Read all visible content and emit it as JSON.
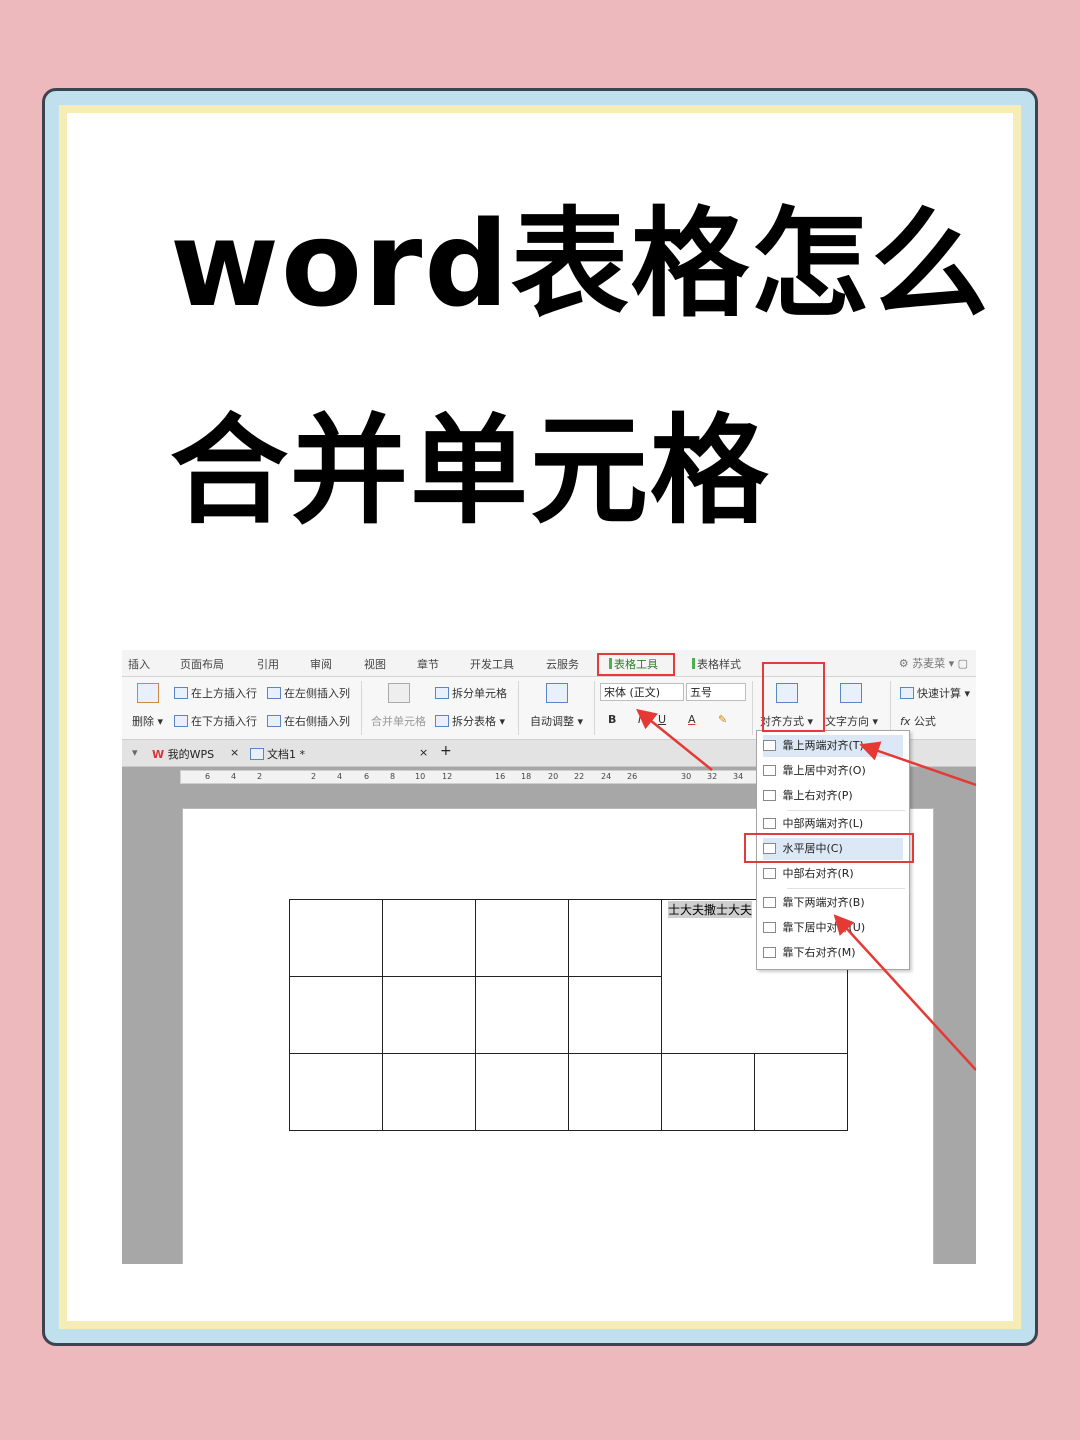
{
  "title": {
    "line1": "word表格怎么",
    "line2": "合并单元格"
  },
  "menubar": {
    "items": [
      "插入",
      "页面布局",
      "引用",
      "审阅",
      "视图",
      "章节",
      "开发工具",
      "云服务",
      "表格工具",
      "表格样式"
    ],
    "user": "苏麦菜"
  },
  "ribbon": {
    "delete": "删除",
    "insert_above": "在上方插入行",
    "insert_below": "在下方插入行",
    "insert_left": "在左侧插入列",
    "insert_right": "在右侧插入列",
    "merge_cells": "合并单元格",
    "split_cells": "拆分单元格",
    "split_table": "拆分表格",
    "auto_fit": "自动调整",
    "font": "宋体 (正文)",
    "size": "五号",
    "bold": "B",
    "italic": "I",
    "underline": "U",
    "font_color": "A",
    "align": "对齐方式",
    "text_direction": "文字方向",
    "quick_calc": "快速计算",
    "formula": "公式",
    "fx": "fx"
  },
  "tabs": {
    "home": "我的WPS",
    "doc": "文档1 *",
    "close": "×",
    "add": "+"
  },
  "ruler": [
    "6",
    "4",
    "2",
    "2",
    "4",
    "6",
    "8",
    "10",
    "12",
    "16",
    "18",
    "20",
    "22",
    "24",
    "26",
    "30",
    "32",
    "34"
  ],
  "cell_text": "士大夫撒士大夫",
  "dropdown": [
    "靠上两端对齐(T)",
    "靠上居中对齐(O)",
    "靠上右对齐(P)",
    "中部两端对齐(L)",
    "水平居中(C)",
    "中部右对齐(R)",
    "靠下两端对齐(B)",
    "靠下居中对齐(U)",
    "靠下右对齐(M)"
  ]
}
